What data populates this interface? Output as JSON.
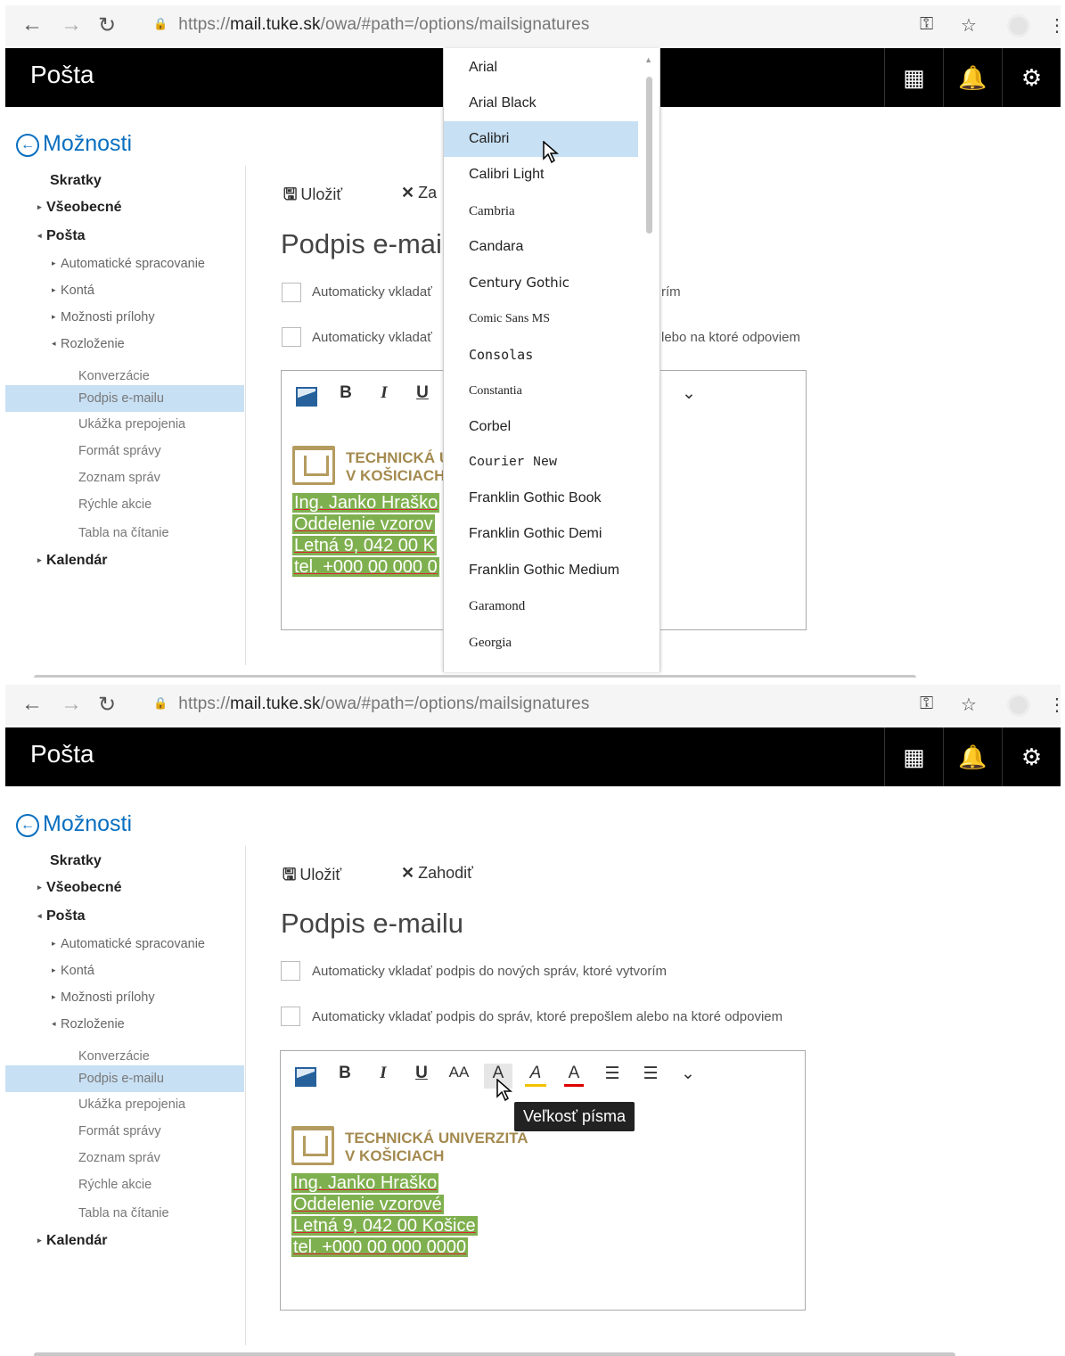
{
  "browser": {
    "url_prefix": "https://",
    "url_domain": "mail.tuke.sk",
    "url_path": "/owa/#path=/options/mailsignatures",
    "back_icon": "arrow-left-icon",
    "forward_icon": "arrow-right-icon",
    "reload_icon": "reload-icon",
    "key_icon": "key-icon",
    "star_icon": "star-icon",
    "menu_icon": "kebab-menu-icon"
  },
  "app": {
    "title": "Pošta",
    "apps_icon": "waffle-icon",
    "bell_icon": "bell-icon",
    "gear_icon": "gear-icon"
  },
  "back_link": "Možnosti",
  "nav": [
    {
      "label": "Skratky",
      "level": 1,
      "arrow": ""
    },
    {
      "label": "Všeobecné",
      "level": 1,
      "arrow": "▸"
    },
    {
      "label": "Pošta",
      "level": 1,
      "arrow": "◂"
    },
    {
      "label": "Automatické spracovanie",
      "level": 2,
      "arrow": "▸"
    },
    {
      "label": "Kontá",
      "level": 2,
      "arrow": "▸"
    },
    {
      "label": "Možnosti prílohy",
      "level": 2,
      "arrow": "▸"
    },
    {
      "label": "Rozloženie",
      "level": 2,
      "arrow": "◂"
    },
    {
      "label": "Konverzácie",
      "level": 3,
      "arrow": ""
    },
    {
      "label": "Podpis e-mailu",
      "level": 3,
      "arrow": "",
      "selected": true
    },
    {
      "label": "Ukážka prepojenia",
      "level": 3,
      "arrow": ""
    },
    {
      "label": "Formát správy",
      "level": 3,
      "arrow": ""
    },
    {
      "label": "Zoznam správ",
      "level": 3,
      "arrow": ""
    },
    {
      "label": "Rýchle akcie",
      "level": 3,
      "arrow": ""
    },
    {
      "label": "Tabla na čítanie",
      "level": 3,
      "arrow": ""
    },
    {
      "label": "Kalendár",
      "level": 1,
      "arrow": "▸"
    }
  ],
  "commands": {
    "save": "Uložiť",
    "save_icon": "floppy-disk-icon",
    "discard": "Zahodiť",
    "discard_partial": "Za",
    "discard_icon": "close-icon"
  },
  "page_title": "Podpis e-mailu",
  "page_title_partial": "Podpis e-mail",
  "checkboxes": [
    {
      "label": "Automaticky vkladať podpis do nových správ, ktoré vytvorím",
      "checked": false
    },
    {
      "label": "Automaticky vkladať podpis do správ, ktoré prepošlem alebo na ktoré odpoviem",
      "checked": false
    }
  ],
  "checkbox_fragments": {
    "first_start": "Automaticky vkladať",
    "first_end": "rím",
    "second_start": "Automaticky vkladať",
    "second_end": "lebo na ktoré odpoviem"
  },
  "toolbar": {
    "bold": "B",
    "italic": "I",
    "underline": "U",
    "font_size_glyph": "AA",
    "font_glyph": "A",
    "highlight_glyph": "A",
    "font_color_glyph": "A",
    "bullets_glyph": "☰",
    "numbering_glyph": "☰",
    "more_glyph": "⌄",
    "tooltip": "Veľkosť písma"
  },
  "signature": {
    "university_line1": "TECHNICKÁ UNIVERZITA",
    "university_line2": "V KOŠICIACH",
    "university_line1_partial": "TECHNICKÁ U",
    "lines": [
      "Ing. Janko Hraško",
      "Oddelenie vzorové",
      "Letná 9, 042 00 Košice",
      "tel. +000 00 000 0000"
    ],
    "lines_partial": [
      "Ing. Janko Hraško",
      "Oddelenie vzorov",
      "Letná 9, 042 00 K",
      "tel. +000 00 000 0"
    ]
  },
  "font_dropdown": {
    "highlighted": "Calibri",
    "options": [
      "Arial",
      "Arial Black",
      "Calibri",
      "Calibri Light",
      "Cambria",
      "Candara",
      "Century Gothic",
      "Comic Sans MS",
      "Consolas",
      "Constantia",
      "Corbel",
      "Courier New",
      "Franklin Gothic Book",
      "Franklin Gothic Demi",
      "Franklin Gothic Medium",
      "Garamond",
      "Georgia"
    ]
  },
  "colors": {
    "accent": "#0a6fbf",
    "header_bg": "#000000",
    "selection_bg": "#c8e0f4",
    "signature_highlight": "#7fb04f",
    "logo_gold": "#b49b5f"
  }
}
